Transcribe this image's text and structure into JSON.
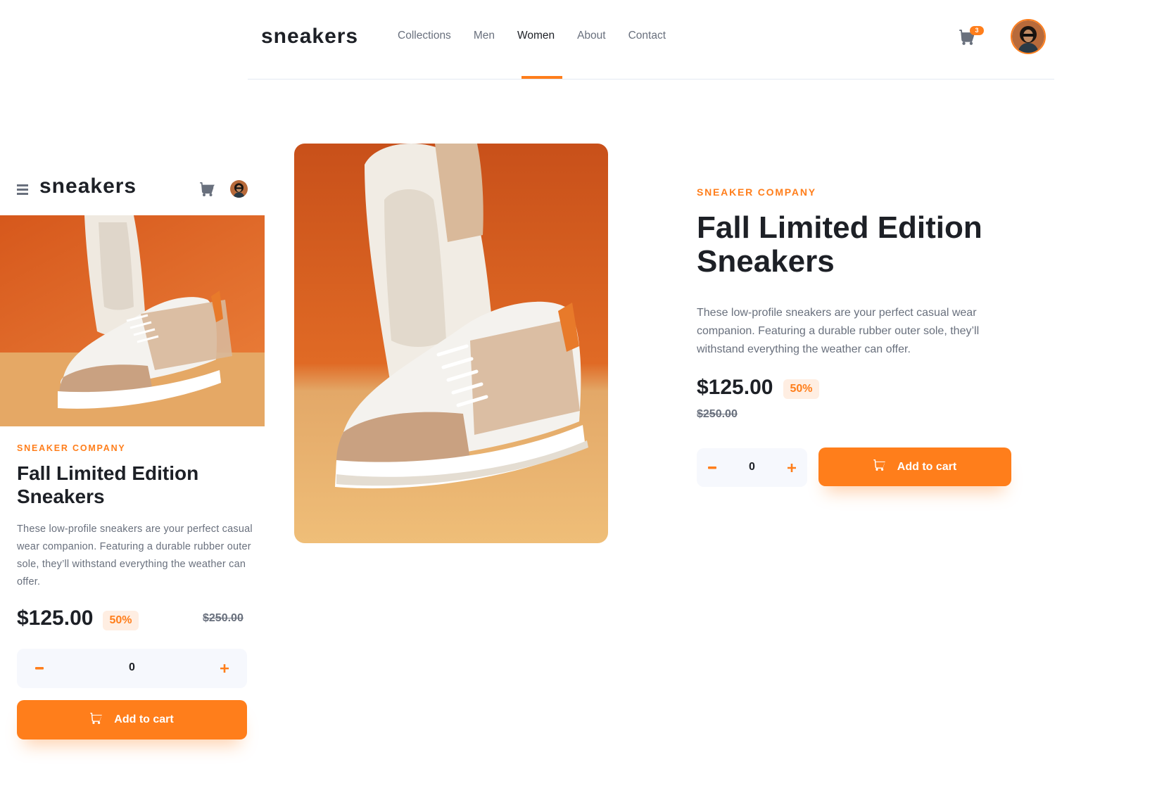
{
  "desktop": {
    "logo": "sneakers",
    "nav": [
      "Collections",
      "Men",
      "Women",
      "About",
      "Contact"
    ],
    "active_nav": "Women",
    "cart_count": "3",
    "product": {
      "company": "SNEAKER COMPANY",
      "title": "Fall Limited Edition Sneakers",
      "description": "These low-profile sneakers are your perfect casual wear companion. Featuring a durable rubber outer sole, they’ll withstand everything the weather can offer.",
      "price": "$125.00",
      "discount": "50%",
      "old_price": "$250.00",
      "quantity": "0",
      "add_to_cart": "Add to cart"
    }
  },
  "mobile": {
    "logo": "sneakers",
    "product": {
      "company": "SNEAKER COMPANY",
      "title": "Fall Limited Edition Sneakers",
      "description": "These low-profile sneakers are your perfect casual wear companion. Featuring a durable rubber outer sole, they’ll withstand everything the weather can offer.",
      "price": "$125.00",
      "discount": "50%",
      "old_price": "$250.00",
      "quantity": "0",
      "add_to_cart": "Add to cart"
    }
  },
  "colors": {
    "accent": "#ff7e1b",
    "accent_pale": "#ffeee2",
    "dark": "#1d2026",
    "gray": "#69707d",
    "light_bg": "#f6f8fd"
  },
  "icons": [
    "menu-icon",
    "cart-icon",
    "minus-icon",
    "plus-icon",
    "avatar"
  ]
}
